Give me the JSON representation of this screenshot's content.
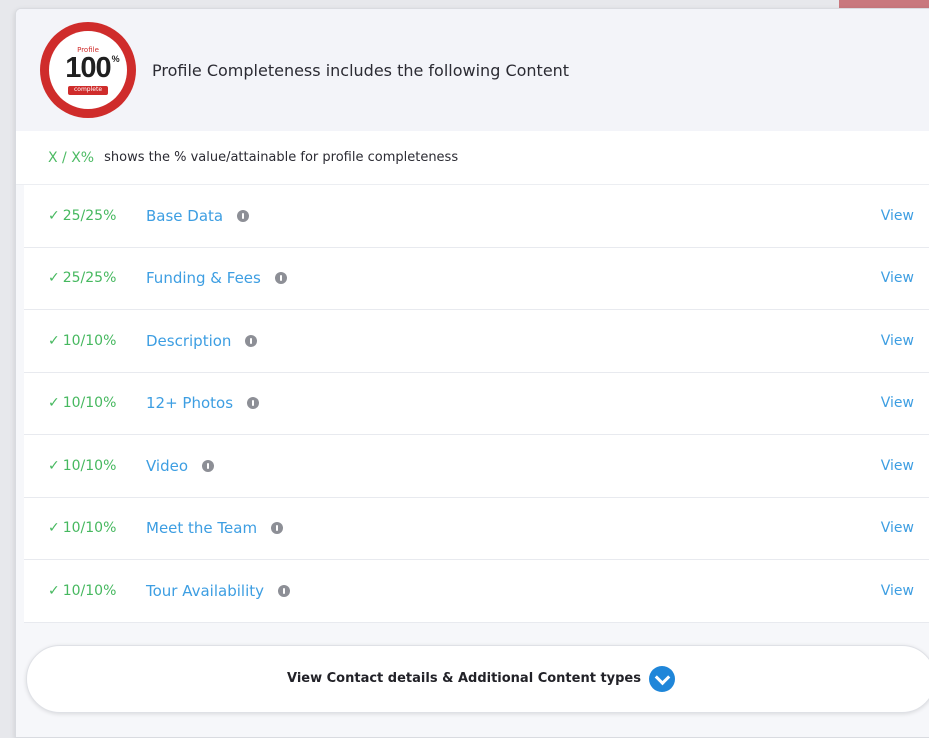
{
  "header": {
    "badge": {
      "top": "Profile",
      "number": "100",
      "percent": "%",
      "bottom": "complete"
    },
    "title": "Profile Completeness includes the following Content"
  },
  "legend": {
    "key": "X / X%",
    "text": "shows the % value/attainable for profile completeness"
  },
  "rows": [
    {
      "score": "25/25%",
      "label": "Base Data",
      "action": "View"
    },
    {
      "score": "25/25%",
      "label": "Funding & Fees",
      "action": "View"
    },
    {
      "score": "10/10%",
      "label": "Description",
      "action": "View"
    },
    {
      "score": "10/10%",
      "label": "12+ Photos",
      "action": "View"
    },
    {
      "score": "10/10%",
      "label": "Video",
      "action": "View"
    },
    {
      "score": "10/10%",
      "label": "Meet the Team",
      "action": "View"
    },
    {
      "score": "10/10%",
      "label": "Tour Availability",
      "action": "View"
    }
  ],
  "footer": {
    "expand_label": "View Contact details & Additional Content types"
  },
  "colors": {
    "badge_red": "#cf2c2b",
    "score_green": "#46b85f",
    "link_blue": "#3d9ee2",
    "chevron_blue": "#1f86d9"
  }
}
